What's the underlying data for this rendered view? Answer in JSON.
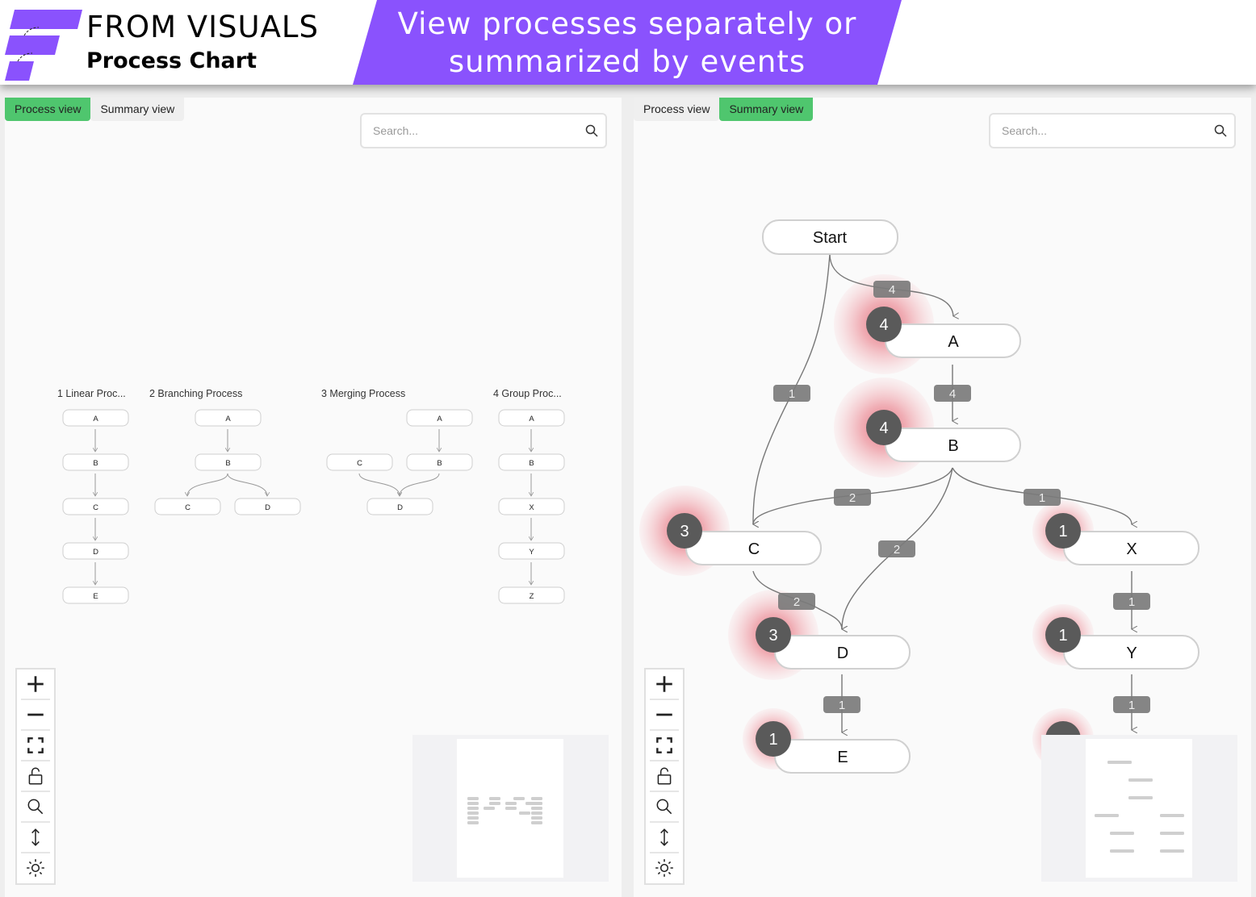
{
  "header": {
    "brand": "FROM VISUALS",
    "subtitle": "Process Chart",
    "banner_line1": "View processes separately or",
    "banner_line2": "summarized by events",
    "brand_color": "#8a52fd"
  },
  "left_panel": {
    "tabs": [
      {
        "label": "Process view",
        "active": true
      },
      {
        "label": "Summary view",
        "active": false
      }
    ],
    "search_placeholder": "Search...",
    "processes": [
      {
        "title": "1 Linear Proc...",
        "nodes": [
          "A",
          "B",
          "C",
          "D",
          "E"
        ],
        "edges": [
          [
            "A",
            "B"
          ],
          [
            "B",
            "C"
          ],
          [
            "C",
            "D"
          ],
          [
            "D",
            "E"
          ]
        ]
      },
      {
        "title": "2 Branching Process",
        "nodes": [
          "A",
          "B",
          "C",
          "D"
        ],
        "edges": [
          [
            "A",
            "B"
          ],
          [
            "B",
            "C"
          ],
          [
            "B",
            "D"
          ]
        ]
      },
      {
        "title": "3 Merging Process",
        "nodes": [
          "A",
          "C",
          "B",
          "D"
        ],
        "edges": [
          [
            "A",
            "B"
          ],
          [
            "C",
            "D"
          ],
          [
            "B",
            "D"
          ]
        ]
      },
      {
        "title": "4 Group Proc...",
        "nodes": [
          "A",
          "B",
          "X",
          "Y",
          "Z"
        ],
        "edges": [
          [
            "A",
            "B"
          ],
          [
            "B",
            "X"
          ],
          [
            "X",
            "Y"
          ],
          [
            "Y",
            "Z"
          ]
        ]
      }
    ]
  },
  "right_panel": {
    "tabs": [
      {
        "label": "Process view",
        "active": false
      },
      {
        "label": "Summary view",
        "active": true
      }
    ],
    "search_placeholder": "Search...",
    "start_label": "Start",
    "nodes": [
      {
        "id": "A",
        "count": "4"
      },
      {
        "id": "B",
        "count": "4"
      },
      {
        "id": "C",
        "count": "3"
      },
      {
        "id": "D",
        "count": "3"
      },
      {
        "id": "E",
        "count": "1"
      },
      {
        "id": "X",
        "count": "1"
      },
      {
        "id": "Y",
        "count": "1"
      }
    ],
    "edges": [
      {
        "from": "Start",
        "to": "A",
        "count": "4"
      },
      {
        "from": "Start",
        "to": "C",
        "count": "1"
      },
      {
        "from": "A",
        "to": "B",
        "count": "4"
      },
      {
        "from": "B",
        "to": "C",
        "count": "2"
      },
      {
        "from": "B",
        "to": "X",
        "count": "1"
      },
      {
        "from": "B",
        "to": "D",
        "count": "2"
      },
      {
        "from": "C",
        "to": "D",
        "count": "2"
      },
      {
        "from": "X",
        "to": "Y",
        "count": "1"
      },
      {
        "from": "D",
        "to": "E",
        "count": "1"
      },
      {
        "from": "Y",
        "to": "Z",
        "count": "1"
      }
    ]
  },
  "toolbar": [
    "zoom-in",
    "zoom-out",
    "fit-view",
    "lock",
    "search",
    "vertical-layout",
    "theme"
  ],
  "colors": {
    "active_tab": "#4fc66e",
    "badge": "#5a5a5a",
    "edge_label": "#7b7b7b",
    "halo": "#e8808a"
  }
}
